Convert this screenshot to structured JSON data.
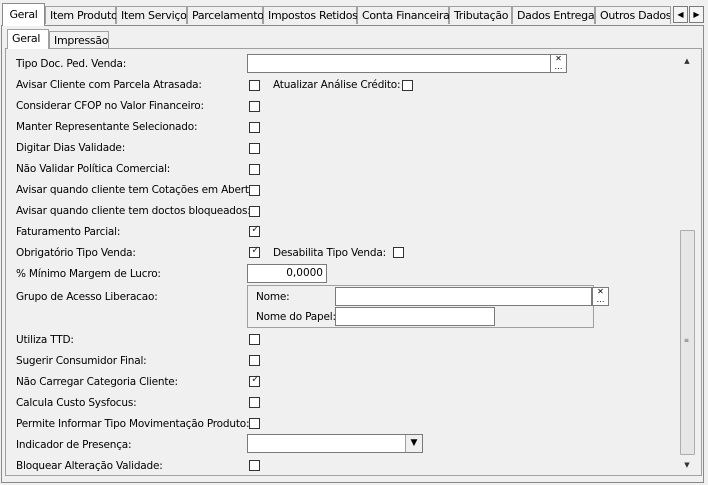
{
  "main_tabs": [
    "Geral",
    "Item Produto",
    "Item Serviço",
    "Parcelamento",
    "Impostos Retidos",
    "Conta Financeira",
    "Tributação",
    "Dados Entrega",
    "Outros Dados"
  ],
  "sub_tabs": [
    "Geral",
    "Impressão"
  ],
  "fields": {
    "tipo_doc_label": "Tipo Doc. Ped. Venda:",
    "tipo_doc_value": "",
    "avisar_parcela_label": "Avisar Cliente com Parcela Atrasada:",
    "avisar_parcela_checked": false,
    "atualizar_credito_label": "Atualizar Análise Crédito:",
    "atualizar_credito_checked": false,
    "cfop_label": "Considerar CFOP no Valor Financeiro:",
    "cfop_checked": false,
    "manter_rep_label": "Manter Representante Selecionado:",
    "manter_rep_checked": false,
    "dias_validade_label": "Digitar Dias Validade:",
    "dias_validade_checked": false,
    "nao_validar_label": "Não Validar Política Comercial:",
    "nao_validar_checked": false,
    "avisar_cotacoes_label": "Avisar quando cliente tem Cotações em Aberto:",
    "avisar_cotacoes_checked": false,
    "avisar_bloqueados_label": "Avisar quando cliente tem doctos bloqueados:",
    "avisar_bloqueados_checked": false,
    "fat_parcial_label": "Faturamento Parcial:",
    "fat_parcial_checked": true,
    "obrig_tipo_label": "Obrigatório Tipo Venda:",
    "obrig_tipo_checked": true,
    "desabilita_tipo_label": "Desabilita Tipo Venda:",
    "desabilita_tipo_checked": false,
    "margem_label": "% Mínimo Margem de Lucro:",
    "margem_value": "0,0000",
    "grupo_label": "Grupo de Acesso Liberacao:",
    "nome_label": "Nome:",
    "nome_value": "",
    "nome_papel_label": "Nome do Papel:",
    "nome_papel_value": "",
    "ttd_label": "Utiliza TTD:",
    "ttd_checked": false,
    "sugerir_label": "Sugerir Consumidor Final:",
    "sugerir_checked": false,
    "nao_carregar_label": "Não Carregar Categoria Cliente:",
    "nao_carregar_checked": true,
    "custo_label": "Calcula Custo Sysfocus:",
    "custo_checked": false,
    "permite_label": "Permite Informar Tipo Movimentação Produto:",
    "permite_checked": false,
    "indicador_label": "Indicador de Presença:",
    "indicador_value": "",
    "bloquear_label": "Bloquear Alteração Validade:",
    "bloquear_checked": false
  }
}
